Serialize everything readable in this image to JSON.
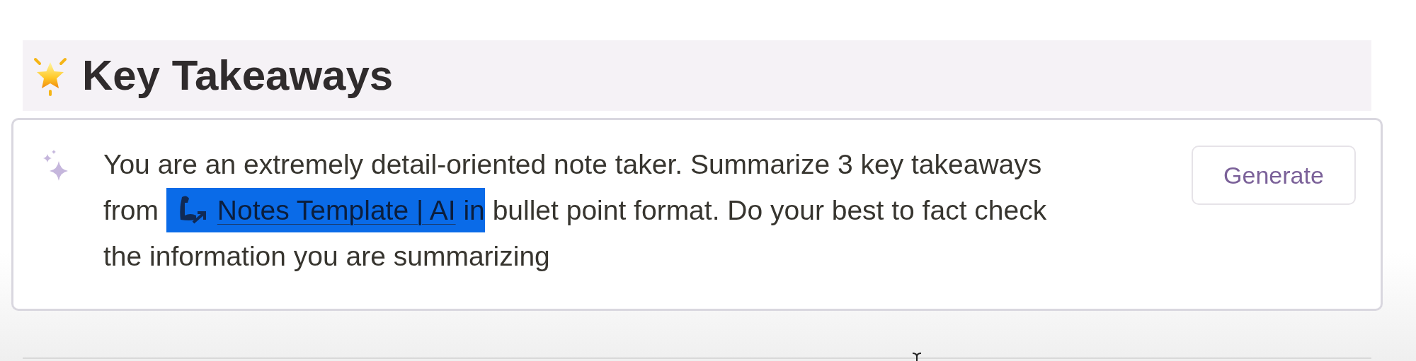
{
  "heading": {
    "text": "Key Takeaways"
  },
  "prompt_block": {
    "parts": [
      {
        "kind": "text",
        "text": "You are an extremely detail-oriented note taker. Summarize 3 key takeaways from ",
        "selected": false
      },
      {
        "kind": "mention",
        "text": "Notes Template | AI",
        "selected": true
      },
      {
        "kind": "text",
        "text": " in",
        "selected": true
      },
      {
        "kind": "text",
        "text": " bullet point format. Do your best to fact check the information you are summarizing",
        "selected": false
      }
    ],
    "button": {
      "label": "Generate"
    }
  }
}
